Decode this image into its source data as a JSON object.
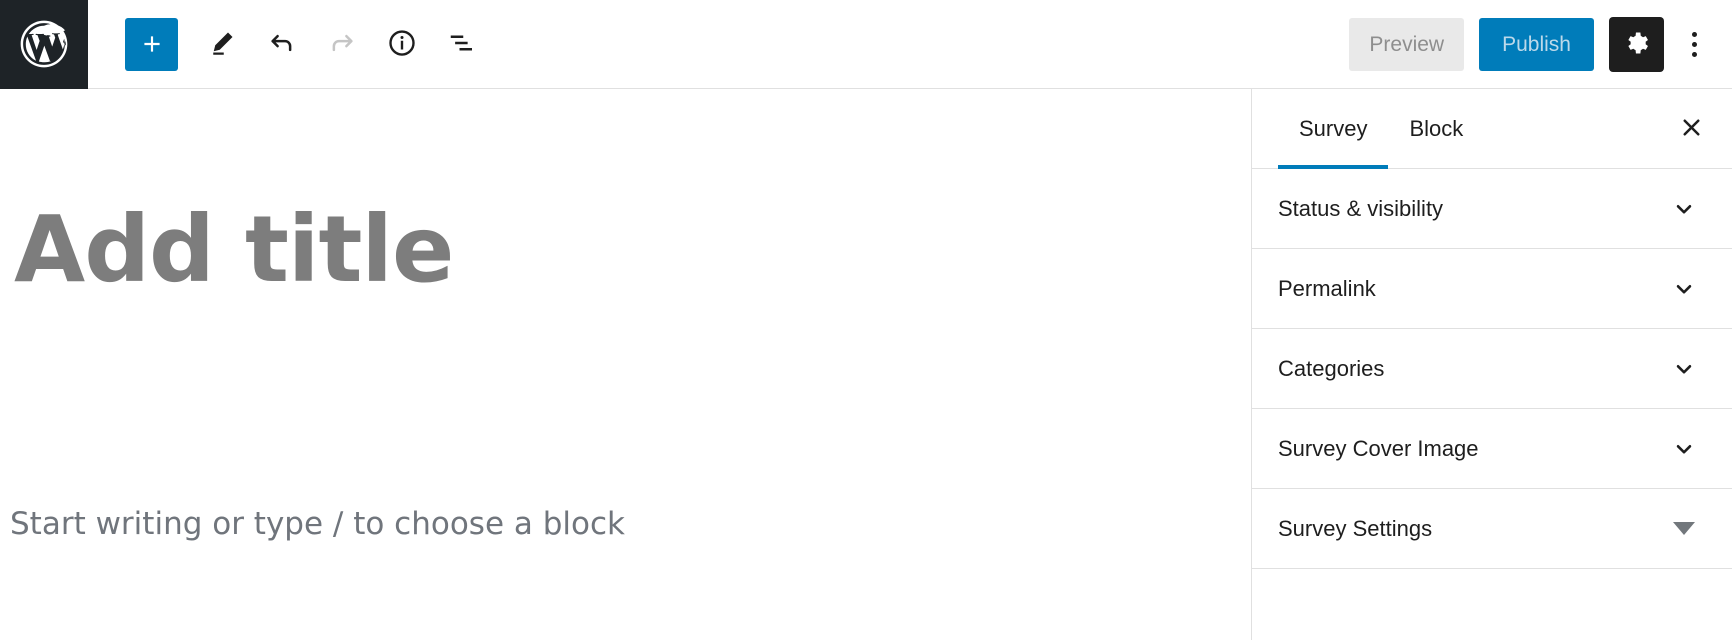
{
  "toolbar": {
    "logo": {
      "icon": "wordpress-logo-icon",
      "label": "WordPress"
    },
    "add_block": {
      "icon": "plus-icon",
      "label": "Add block"
    },
    "tools": [
      {
        "name": "edit-pencil",
        "icon": "pencil-icon",
        "label": "Tools",
        "disabled": false
      },
      {
        "name": "undo",
        "icon": "undo-arrow-icon",
        "label": "Undo",
        "disabled": false
      },
      {
        "name": "redo",
        "icon": "redo-arrow-icon",
        "label": "Redo",
        "disabled": true
      },
      {
        "name": "details",
        "icon": "info-circle-icon",
        "label": "Details",
        "disabled": false
      },
      {
        "name": "list-view",
        "icon": "list-view-icon",
        "label": "List view",
        "disabled": false
      }
    ],
    "preview_label": "Preview",
    "publish_label": "Publish",
    "settings": {
      "icon": "gear-icon",
      "label": "Settings"
    },
    "more_menu": {
      "icon": "kebab-menu-icon",
      "label": "Options"
    }
  },
  "editor": {
    "title_placeholder": "Add title",
    "body_placeholder": "Start writing or type / to choose a block"
  },
  "sidebar": {
    "tabs": [
      {
        "label": "Survey",
        "active": true
      },
      {
        "label": "Block",
        "active": false
      }
    ],
    "close": {
      "icon": "close-icon",
      "label": "Close settings"
    },
    "panels": [
      {
        "label": "Status & visibility",
        "icon": "chevron-down-icon",
        "expanded": false
      },
      {
        "label": "Permalink",
        "icon": "chevron-down-icon",
        "expanded": false
      },
      {
        "label": "Categories",
        "icon": "chevron-down-icon",
        "expanded": false
      },
      {
        "label": "Survey Cover Image",
        "icon": "chevron-down-icon",
        "expanded": false
      },
      {
        "label": "Survey Settings",
        "icon": "triangle-down-icon",
        "expanded": false
      }
    ]
  },
  "colors": {
    "brand_blue": "#007cba",
    "admin_dark": "#1e2327",
    "button_dark": "#1e1e1e",
    "placeholder_gray": "#7d7d7d",
    "border_gray": "#e0e0e0"
  }
}
